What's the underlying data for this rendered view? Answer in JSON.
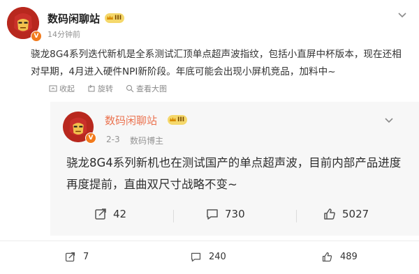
{
  "post": {
    "author": "数码闲聊站",
    "level_badge": "III",
    "time": "14分钟前",
    "text": "骁龙8G4系列迭代新机是全系测试汇顶单点超声波指纹，包括小直屏中杯版本，现在还相对早期，4月进入硬件NPI新阶段。年底可能会出现小屏机竞品，加料中~",
    "actions": {
      "collect": "收起",
      "repost": "旋转",
      "view_large": "查看大图"
    }
  },
  "quoted": {
    "author": "数码闲聊站",
    "level_badge": "III",
    "date": "2-3",
    "role": "数码博主",
    "text": "骁龙8G4系列新机也在测试国产的单点超声波，目前内部产品进度再度提前，直曲双尺寸战略不变~",
    "stats": {
      "reposts": "42",
      "comments": "730",
      "likes": "5027"
    }
  },
  "bottom": {
    "reposts": "7",
    "comments": "240",
    "likes": "489"
  },
  "colors": {
    "accent_orange": "#f27a1c",
    "badge_gold": "#f5d86b",
    "meta_gray": "#939393",
    "quote_bg": "#f7f7f7"
  }
}
